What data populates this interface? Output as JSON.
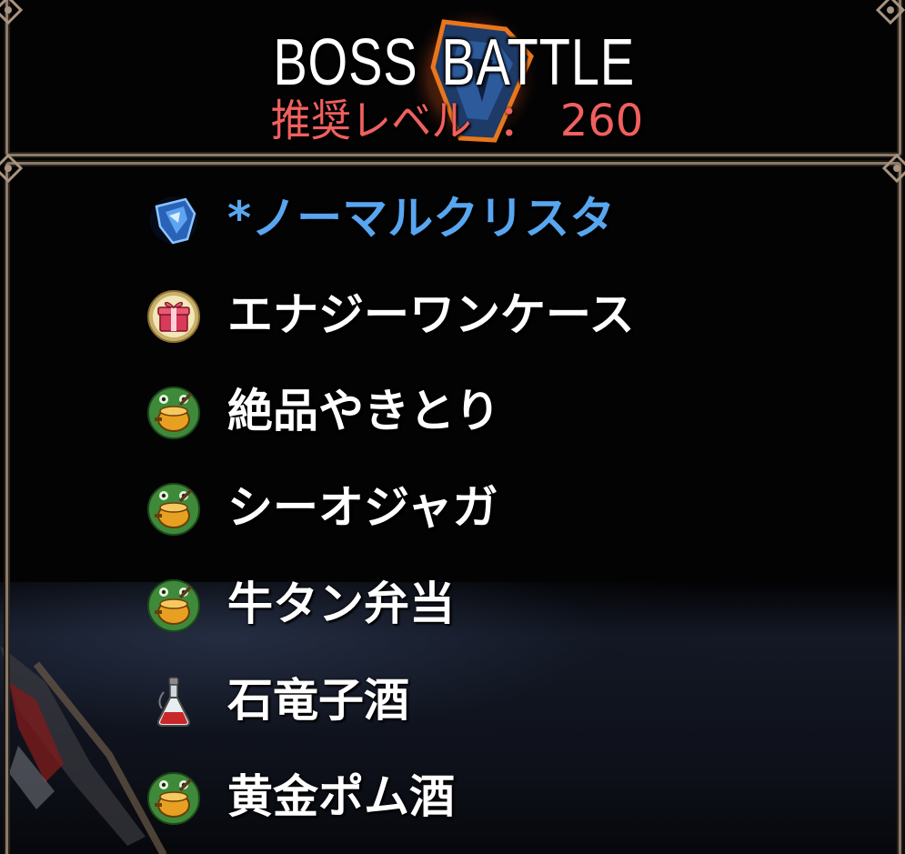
{
  "header": {
    "title": "BOSS BATTLE",
    "level_label": "推奨レベル",
    "level_sep": "：",
    "level_value": "260"
  },
  "colors": {
    "title": "#ffffff",
    "level": "#f0605e",
    "highlight": "#58a6f0",
    "item": "#ffffff",
    "frame": "#8a7a6a"
  },
  "rewards": [
    {
      "name": "*ノーマルクリスタ",
      "icon": "blue-crystal-icon",
      "highlight": true
    },
    {
      "name": "エナジーワンケース",
      "icon": "gift-box-icon",
      "highlight": false
    },
    {
      "name": "絶品やきとり",
      "icon": "food-pot-icon",
      "highlight": false
    },
    {
      "name": "シーオジャガ",
      "icon": "food-pot-icon",
      "highlight": false
    },
    {
      "name": "牛タン弁当",
      "icon": "food-pot-icon",
      "highlight": false
    },
    {
      "name": "石竜子酒",
      "icon": "potion-flask-icon",
      "highlight": false
    },
    {
      "name": "黄金ポム酒",
      "icon": "food-pot-icon",
      "highlight": false
    }
  ]
}
